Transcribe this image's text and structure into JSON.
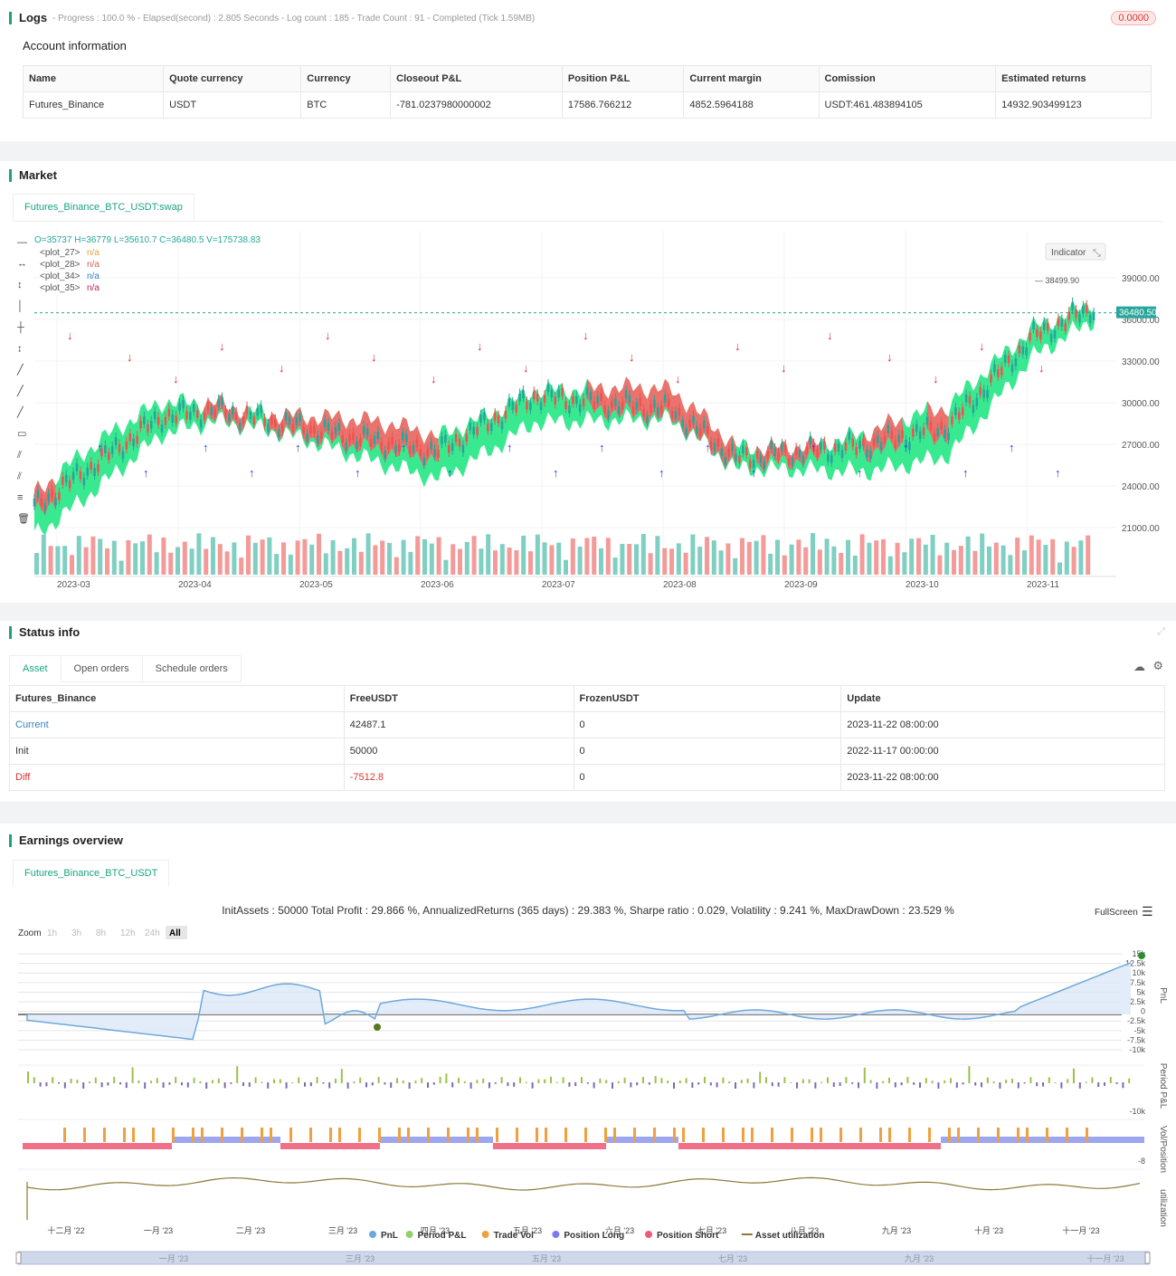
{
  "logs": {
    "title": "Logs",
    "meta": "- Progress : 100.0 % - Elapsed(second) : 2.805  Seconds - Log count : 185 - Trade Count : 91 - Completed (Tick 1.59MB)",
    "badge": "0.0000",
    "account_title": "Account information",
    "headers": [
      "Name",
      "Quote currency",
      "Currency",
      "Closeout P&L",
      "Position P&L",
      "Current margin",
      "Comission",
      "Estimated returns"
    ],
    "row": [
      "Futures_Binance",
      "USDT",
      "BTC",
      "-781.0237980000002",
      "17586.766212",
      "4852.5964188",
      "USDT:461.483894105",
      "14932.903499123"
    ]
  },
  "market": {
    "title": "Market",
    "tab": "Futures_Binance_BTC_USDT:swap",
    "ohlc": "O=35737 H=36779 L=35610.7 C=36480.5 V=175738.83",
    "legend": [
      {
        "name": "<plot_27>",
        "value": "n/a",
        "color": "#e6a23c"
      },
      {
        "name": "<plot_28>",
        "value": "n/a",
        "color": "#e05c5c"
      },
      {
        "name": "<plot_34>",
        "value": "n/a",
        "color": "#3b82c4"
      },
      {
        "name": "<plot_35>",
        "value": "n/a",
        "color": "#c02060"
      }
    ],
    "indicator_btn": "Indicator",
    "price_label": "36480.50",
    "high_label": "38499.90",
    "y_ticks": [
      "39000.00",
      "36000.00",
      "33000.00",
      "30000.00",
      "27000.00",
      "24000.00",
      "21000.00"
    ],
    "x_ticks": [
      "2023-03",
      "2023-04",
      "2023-05",
      "2023-06",
      "2023-07",
      "2023-08",
      "2023-09",
      "2023-10",
      "2023-11"
    ]
  },
  "status": {
    "title": "Status info",
    "tabs": [
      "Asset",
      "Open orders",
      "Schedule orders"
    ],
    "headers": [
      "Futures_Binance",
      "FreeUSDT",
      "FrozenUSDT",
      "Update"
    ],
    "rows": [
      [
        "Current",
        "42487.1",
        "0",
        "2023-11-22 08:00:00"
      ],
      [
        "Init",
        "50000",
        "0",
        "2022-11-17 00:00:00"
      ],
      [
        "Diff",
        "-7512.8",
        "0",
        "2023-11-22 08:00:00"
      ]
    ]
  },
  "earnings": {
    "title": "Earnings overview",
    "tab": "Futures_Binance_BTC_USDT",
    "summary": "InitAssets : 50000 Total Profit : 29.866 %, AnnualizedReturns (365 days) : 29.383 %, Sharpe ratio : 0.029, Volatility : 9.241 %, MaxDrawDown : 23.529 %",
    "fullscreen": "FullScreen",
    "zoom_label": "Zoom",
    "zoom_opts": [
      "1h",
      "3h",
      "8h",
      "12h",
      "24h",
      "All"
    ],
    "pnl_ticks": [
      "15k",
      "12.5k",
      "10k",
      "7.5k",
      "5k",
      "2.5k",
      "0",
      "-2.5k",
      "-5k",
      "-7.5k",
      "-10k"
    ],
    "axis_labels": [
      "PnL",
      "Period P&L",
      "Vol/Position",
      "utilization"
    ],
    "period_tick": "-10k",
    "vol_tick": "-8",
    "x_ticks": [
      "十二月 '22",
      "一月 '23",
      "二月 '23",
      "三月 '23",
      "四月 '23",
      "五月 '23",
      "六月 '23",
      "七月 '23",
      "八月 '23",
      "九月 '23",
      "十月 '23",
      "十一月 '23"
    ],
    "nav_ticks": [
      "一月 '23",
      "三月 '23",
      "五月 '23",
      "七月 '23",
      "九月 '23",
      "十一月 '23"
    ],
    "legend": [
      {
        "name": "PnL",
        "color": "#6fa8dc"
      },
      {
        "name": "Period P&L",
        "color": "#8fd16a"
      },
      {
        "name": "Trade Vol",
        "color": "#f0a040"
      },
      {
        "name": "Position Long",
        "color": "#7b7bef"
      },
      {
        "name": "Position Short",
        "color": "#f05a7a"
      },
      {
        "name": "Asset utilization",
        "color": "#8a7a3a"
      }
    ]
  },
  "colors": {
    "accent": "#1aa37f",
    "up": "#2ee88a",
    "down": "#f46b6b"
  }
}
